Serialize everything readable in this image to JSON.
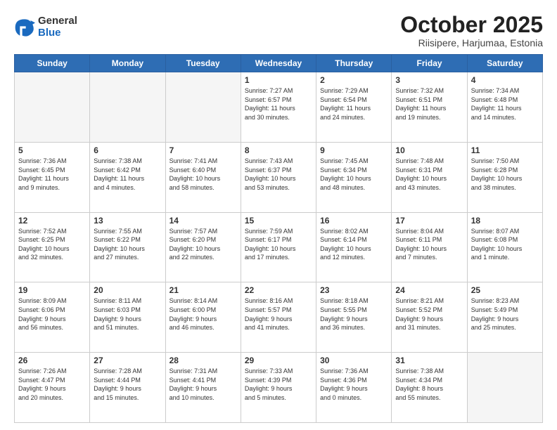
{
  "header": {
    "logo_general": "General",
    "logo_blue": "Blue",
    "month_title": "October 2025",
    "subtitle": "Riisipere, Harjumaa, Estonia"
  },
  "weekdays": [
    "Sunday",
    "Monday",
    "Tuesday",
    "Wednesday",
    "Thursday",
    "Friday",
    "Saturday"
  ],
  "weeks": [
    [
      {
        "day": "",
        "info": ""
      },
      {
        "day": "",
        "info": ""
      },
      {
        "day": "",
        "info": ""
      },
      {
        "day": "1",
        "info": "Sunrise: 7:27 AM\nSunset: 6:57 PM\nDaylight: 11 hours\nand 30 minutes."
      },
      {
        "day": "2",
        "info": "Sunrise: 7:29 AM\nSunset: 6:54 PM\nDaylight: 11 hours\nand 24 minutes."
      },
      {
        "day": "3",
        "info": "Sunrise: 7:32 AM\nSunset: 6:51 PM\nDaylight: 11 hours\nand 19 minutes."
      },
      {
        "day": "4",
        "info": "Sunrise: 7:34 AM\nSunset: 6:48 PM\nDaylight: 11 hours\nand 14 minutes."
      }
    ],
    [
      {
        "day": "5",
        "info": "Sunrise: 7:36 AM\nSunset: 6:45 PM\nDaylight: 11 hours\nand 9 minutes."
      },
      {
        "day": "6",
        "info": "Sunrise: 7:38 AM\nSunset: 6:42 PM\nDaylight: 11 hours\nand 4 minutes."
      },
      {
        "day": "7",
        "info": "Sunrise: 7:41 AM\nSunset: 6:40 PM\nDaylight: 10 hours\nand 58 minutes."
      },
      {
        "day": "8",
        "info": "Sunrise: 7:43 AM\nSunset: 6:37 PM\nDaylight: 10 hours\nand 53 minutes."
      },
      {
        "day": "9",
        "info": "Sunrise: 7:45 AM\nSunset: 6:34 PM\nDaylight: 10 hours\nand 48 minutes."
      },
      {
        "day": "10",
        "info": "Sunrise: 7:48 AM\nSunset: 6:31 PM\nDaylight: 10 hours\nand 43 minutes."
      },
      {
        "day": "11",
        "info": "Sunrise: 7:50 AM\nSunset: 6:28 PM\nDaylight: 10 hours\nand 38 minutes."
      }
    ],
    [
      {
        "day": "12",
        "info": "Sunrise: 7:52 AM\nSunset: 6:25 PM\nDaylight: 10 hours\nand 32 minutes."
      },
      {
        "day": "13",
        "info": "Sunrise: 7:55 AM\nSunset: 6:22 PM\nDaylight: 10 hours\nand 27 minutes."
      },
      {
        "day": "14",
        "info": "Sunrise: 7:57 AM\nSunset: 6:20 PM\nDaylight: 10 hours\nand 22 minutes."
      },
      {
        "day": "15",
        "info": "Sunrise: 7:59 AM\nSunset: 6:17 PM\nDaylight: 10 hours\nand 17 minutes."
      },
      {
        "day": "16",
        "info": "Sunrise: 8:02 AM\nSunset: 6:14 PM\nDaylight: 10 hours\nand 12 minutes."
      },
      {
        "day": "17",
        "info": "Sunrise: 8:04 AM\nSunset: 6:11 PM\nDaylight: 10 hours\nand 7 minutes."
      },
      {
        "day": "18",
        "info": "Sunrise: 8:07 AM\nSunset: 6:08 PM\nDaylight: 10 hours\nand 1 minute."
      }
    ],
    [
      {
        "day": "19",
        "info": "Sunrise: 8:09 AM\nSunset: 6:06 PM\nDaylight: 9 hours\nand 56 minutes."
      },
      {
        "day": "20",
        "info": "Sunrise: 8:11 AM\nSunset: 6:03 PM\nDaylight: 9 hours\nand 51 minutes."
      },
      {
        "day": "21",
        "info": "Sunrise: 8:14 AM\nSunset: 6:00 PM\nDaylight: 9 hours\nand 46 minutes."
      },
      {
        "day": "22",
        "info": "Sunrise: 8:16 AM\nSunset: 5:57 PM\nDaylight: 9 hours\nand 41 minutes."
      },
      {
        "day": "23",
        "info": "Sunrise: 8:18 AM\nSunset: 5:55 PM\nDaylight: 9 hours\nand 36 minutes."
      },
      {
        "day": "24",
        "info": "Sunrise: 8:21 AM\nSunset: 5:52 PM\nDaylight: 9 hours\nand 31 minutes."
      },
      {
        "day": "25",
        "info": "Sunrise: 8:23 AM\nSunset: 5:49 PM\nDaylight: 9 hours\nand 25 minutes."
      }
    ],
    [
      {
        "day": "26",
        "info": "Sunrise: 7:26 AM\nSunset: 4:47 PM\nDaylight: 9 hours\nand 20 minutes."
      },
      {
        "day": "27",
        "info": "Sunrise: 7:28 AM\nSunset: 4:44 PM\nDaylight: 9 hours\nand 15 minutes."
      },
      {
        "day": "28",
        "info": "Sunrise: 7:31 AM\nSunset: 4:41 PM\nDaylight: 9 hours\nand 10 minutes."
      },
      {
        "day": "29",
        "info": "Sunrise: 7:33 AM\nSunset: 4:39 PM\nDaylight: 9 hours\nand 5 minutes."
      },
      {
        "day": "30",
        "info": "Sunrise: 7:36 AM\nSunset: 4:36 PM\nDaylight: 9 hours\nand 0 minutes."
      },
      {
        "day": "31",
        "info": "Sunrise: 7:38 AM\nSunset: 4:34 PM\nDaylight: 8 hours\nand 55 minutes."
      },
      {
        "day": "",
        "info": ""
      }
    ]
  ]
}
